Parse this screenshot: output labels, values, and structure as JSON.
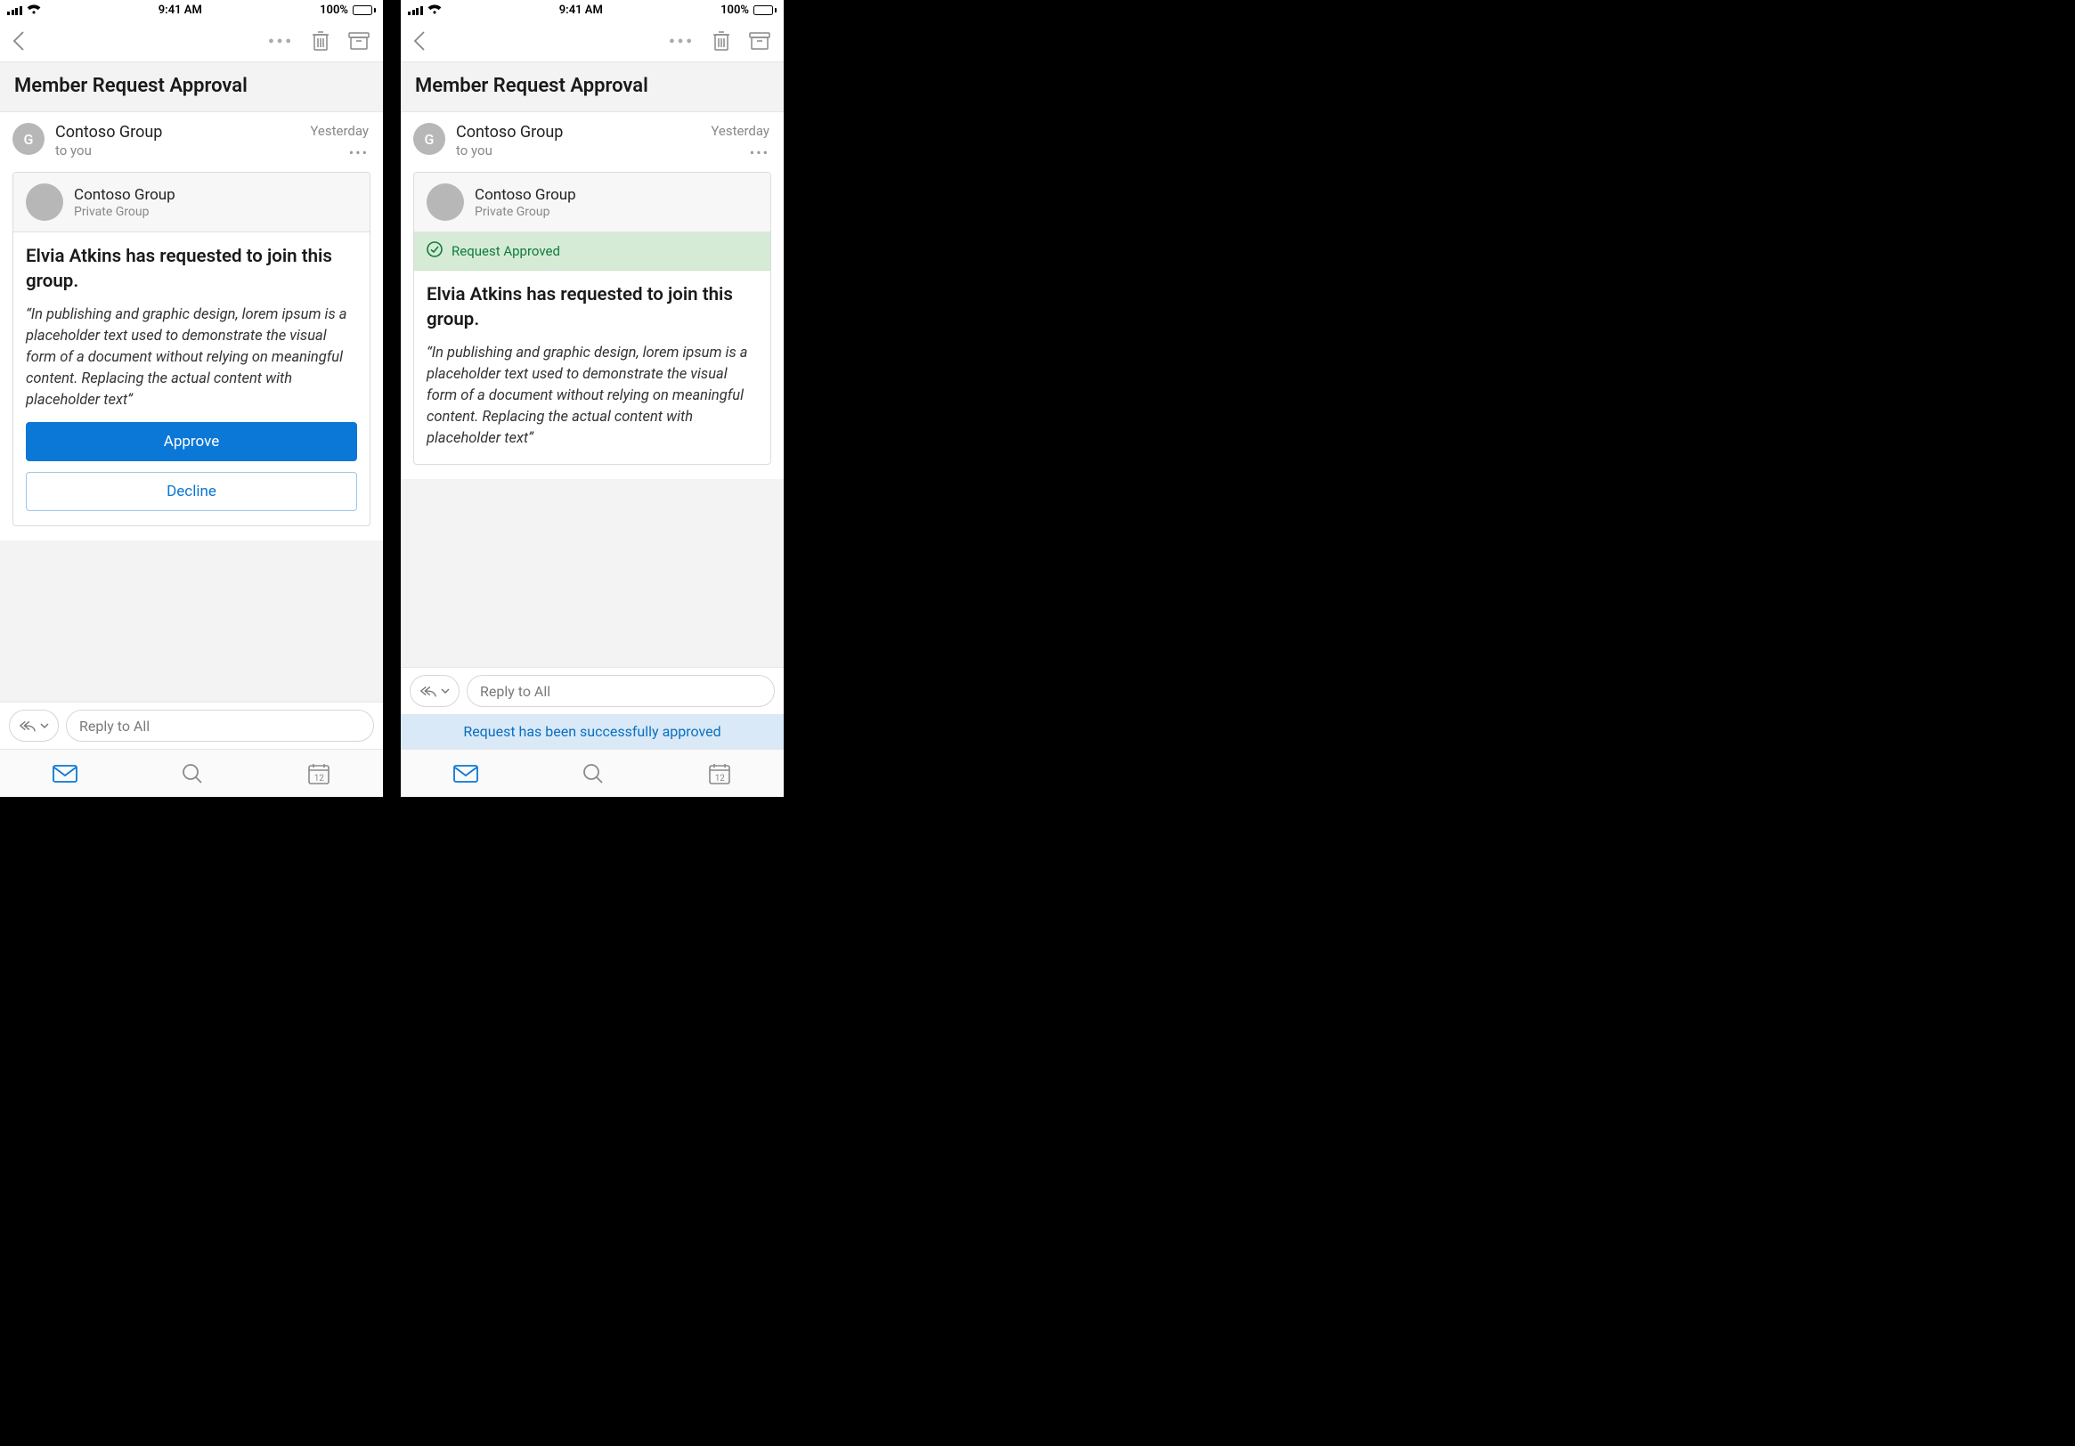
{
  "statusbar": {
    "time": "9:41 AM",
    "battery": "100%"
  },
  "navbar": {},
  "subject": "Member Request Approval",
  "sender": {
    "avatar_initial": "G",
    "name": "Contoso Group",
    "to": "to you",
    "date": "Yesterday"
  },
  "card": {
    "group_name": "Contoso Group",
    "group_type": "Private Group",
    "approved_label": "Request Approved",
    "request_title": "Elvia Atkins has requested to join this group.",
    "request_quote": "“In publishing and graphic design, lorem ipsum is a placeholder text used to demonstrate the visual form of a document without relying on meaningful content. Replacing the actual content with placeholder text”",
    "approve_label": "Approve",
    "decline_label": "Decline"
  },
  "reply": {
    "placeholder": "Reply to All"
  },
  "toast": "Request has been successfully approved",
  "tabbar": {
    "calendar_day": "12"
  }
}
